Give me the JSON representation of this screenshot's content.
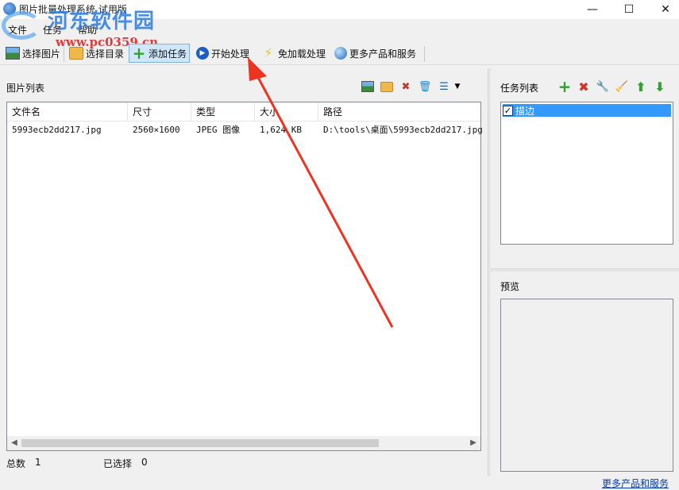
{
  "window": {
    "title": "图片批量处理系统 试用版",
    "controls": {
      "minimize": "—",
      "maximize": "☐",
      "close": "✕"
    }
  },
  "watermark": {
    "text": "河东软件园",
    "url": "www.pc0359.cn"
  },
  "menu": [
    "文件",
    "任务",
    "帮助"
  ],
  "toolbar": {
    "select_images": "选择图片",
    "select_dir": "选择目录",
    "add_task": "添加任务",
    "start": "开始处理",
    "noload": "免加载处理",
    "more": "更多产品和服务"
  },
  "image_list": {
    "title": "图片列表",
    "columns": [
      "文件名",
      "尺寸",
      "类型",
      "大小",
      "路径"
    ],
    "rows": [
      {
        "name": "5993ecb2dd217.jpg",
        "size": "2560×1600",
        "type": "JPEG 图像",
        "filesize": "1,624 KB",
        "path": "D:\\tools\\桌面\\5993ecb2dd217.jpg"
      }
    ]
  },
  "status": {
    "total_label": "总数",
    "total": "1",
    "selected_label": "已选择",
    "selected": "0"
  },
  "task_list": {
    "title": "任务列表",
    "items": [
      {
        "label": "描边",
        "checked": true
      }
    ]
  },
  "preview": {
    "title": "预览"
  },
  "footer_link": "更多产品和服务",
  "colors": {
    "selection": "#3399ff",
    "annotation_arrow": "#ee3322"
  }
}
